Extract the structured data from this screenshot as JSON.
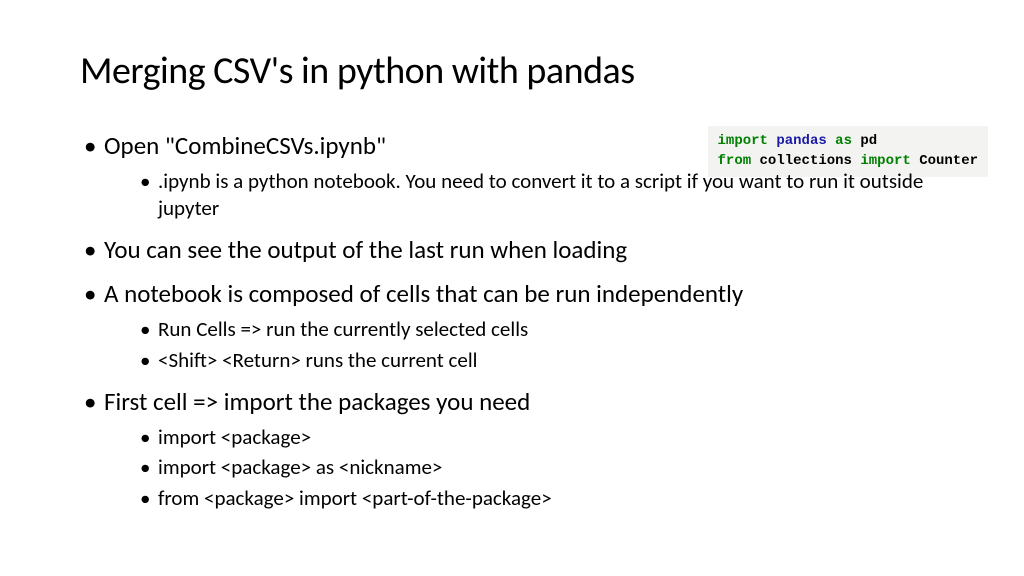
{
  "title": "Merging CSV's in python with pandas",
  "code": {
    "line1": {
      "import": "import",
      "mod": "pandas",
      "as": "as",
      "alias": "pd"
    },
    "line2": {
      "from": "from",
      "mod": "collections",
      "import": "import",
      "name": "Counter"
    }
  },
  "bullets": {
    "b1": "Open \"CombineCSVs.ipynb\"",
    "b1_sub1": ".ipynb is a python notebook. You need to convert it to a script if you want to run it outside jupyter",
    "b2": " You can see the output of the last run when loading",
    "b3": "A notebook is composed of cells that can be run independently",
    "b3_sub1": "Run Cells => run the currently selected cells",
    "b3_sub2": "<Shift> <Return> runs the current cell",
    "b4": "First cell => import the packages you need",
    "b4_sub1": "import <package>",
    "b4_sub2": "import <package> as <nickname>",
    "b4_sub3": "from <package> import <part-of-the-package>"
  }
}
